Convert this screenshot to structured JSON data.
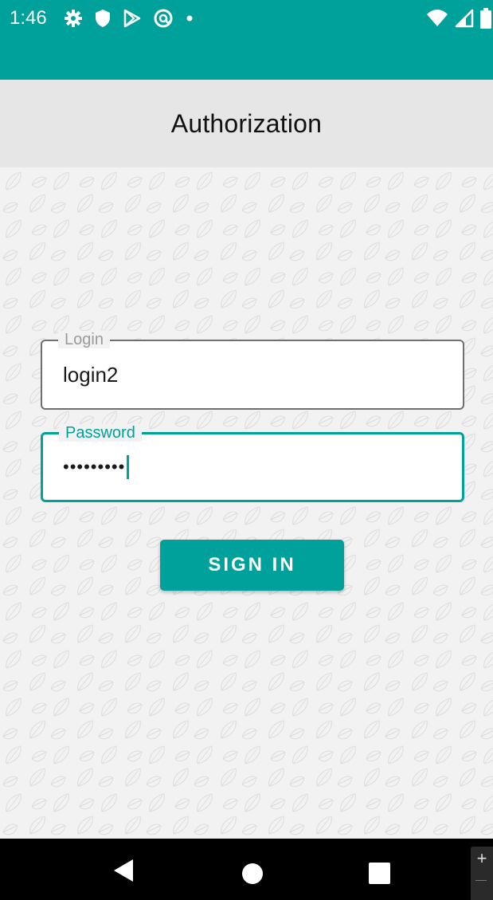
{
  "status_bar": {
    "time": "1:46",
    "left_icons": [
      "gear-icon",
      "shield-icon",
      "play-store-icon",
      "at-sign-icon",
      "dot-icon"
    ],
    "right_icons": [
      "wifi-icon",
      "signal-icon",
      "battery-icon"
    ],
    "color": "#00a19b"
  },
  "header": {
    "title": "Authorization"
  },
  "form": {
    "login": {
      "label": "Login",
      "value": "login2"
    },
    "password": {
      "label": "Password",
      "value": "•••••••••"
    },
    "sign_in_label": "SIGN IN"
  },
  "nav_bar": {
    "buttons": [
      "back-icon",
      "home-icon",
      "recents-icon"
    ]
  },
  "side_controls": {
    "plus": "+"
  },
  "colors": {
    "accent": "#00a19b",
    "title_bar": "#e6e6e6",
    "background": "#f2f2f2"
  }
}
